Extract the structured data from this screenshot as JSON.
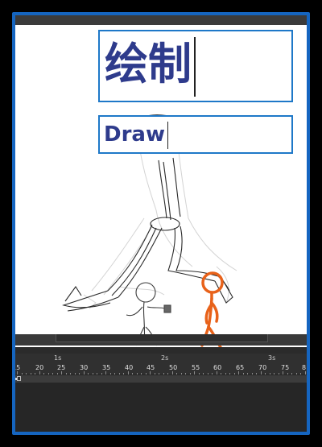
{
  "canvas": {
    "title_zh": "绘制",
    "title_en": "Draw"
  },
  "timeline": {
    "seconds": [
      "1s",
      "2s",
      "3s"
    ],
    "frame_numbers": [
      "15",
      "20",
      "25",
      "30",
      "35",
      "40",
      "45",
      "50",
      "55",
      "60",
      "65",
      "70",
      "75",
      "8"
    ]
  },
  "colors": {
    "frame_border": "#1565c0",
    "title_text": "#2e3b8c",
    "title_box_border": "#1e78c8",
    "stick_figure": "#e8621a"
  }
}
